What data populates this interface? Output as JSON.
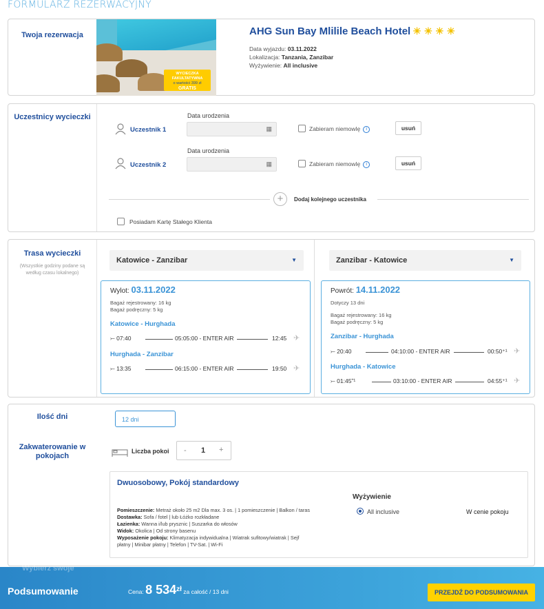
{
  "page": {
    "title": "FORMULARZ REZERWACYJNY"
  },
  "reservation": {
    "label": "Twoja rezerwacja",
    "hotel_name": "AHG Sun Bay Mlilile Beach Hotel",
    "stars": "☀ ☀ ☀ ☀",
    "promo_line1": "WYCIECZKA FAKULTATYWNA",
    "promo_line2": "o wartości 399 zł",
    "promo_line3": "GRATIS",
    "departure_label": "Data wyjazdu:",
    "departure_value": "03.11.2022",
    "location_label": "Lokalizacja:",
    "location_value": "Tanzania, Zanzibar",
    "board_label": "Wyżywienie:",
    "board_value": "All inclusive"
  },
  "participants": {
    "label": "Uczestnicy wycieczki",
    "birth_label": "Data urodzenia",
    "infant_label": "Zabieram niemowlę",
    "remove_label": "usuń",
    "list": [
      "Uczestnik 1",
      "Uczestnik 2"
    ],
    "add_label": "Dodaj kolejnego uczestnika",
    "loyalty_label": "Posiadam Kartę Stałego Klienta"
  },
  "route": {
    "label": "Trasa wycieczki",
    "note": "(Wszystkie godziny podane są według czasu lokalnego)",
    "outbound_select": "Katowice - Zanzibar",
    "return_select": "Zanzibar - Katowice",
    "outbound": {
      "head_label": "Wylot:",
      "date": "03.11.2022",
      "baggage1": "Bagaż rejestrowany: 16 kg",
      "baggage2": "Bagaż podręczny: 5 kg",
      "legs": [
        {
          "route": "Katowice - Hurghada",
          "dep": "07:40",
          "info": "05:05:00 - ENTER AIR",
          "arr": "12:45"
        },
        {
          "route": "Hurghada - Zanzibar",
          "dep": "13:35",
          "info": "06:15:00 - ENTER AIR",
          "arr": "19:50"
        }
      ]
    },
    "inbound": {
      "head_label": "Powrót:",
      "date": "14.11.2022",
      "days": "Dotyczy 13 dni",
      "baggage1": "Bagaż rejestrowany: 16 kg",
      "baggage2": "Bagaż podręczny: 5 kg",
      "legs": [
        {
          "route": "Zanzibar - Hurghada",
          "dep": "20:40",
          "info": "04:10:00 - ENTER AIR",
          "arr": "00:50⁺¹"
        },
        {
          "route": "Hurghada - Katowice",
          "dep": "01:45⁺¹",
          "info": "03:10:00 - ENTER AIR",
          "arr": "04:55⁺¹"
        }
      ]
    }
  },
  "stay": {
    "days_label": "Ilość dni",
    "days_value": "12 dni",
    "accommodation_label": "Zakwaterowanie w pokojach",
    "rooms_label": "Liczba pokoi",
    "rooms_minus": "-",
    "rooms_count": "1",
    "rooms_plus": "+",
    "room_title": "Dwuosobowy, Pokój standardowy",
    "board_heading": "Wyżywienie",
    "board_option": "All inclusive",
    "board_price": "W cenie pokoju",
    "details": [
      {
        "k": "Pomieszczenie:",
        "v": " Metraż około 25 m2 Dla max. 3 os. | 1 pomieszczenie | Balkon / taras"
      },
      {
        "k": "Dostawka:",
        "v": " Sofa / fotel | lub Łóżko rozkładane"
      },
      {
        "k": "Łazienka:",
        "v": " Wanna i/lub prysznic | Suszarka do włosów"
      },
      {
        "k": "Widok:",
        "v": " Okolica | Od strony basenu"
      },
      {
        "k": "Wyposażenie pokoju:",
        "v": " Klimatyzacja indywidualna | Wiatrak sufitowy/wiatrak | Sejf"
      },
      {
        "k": "",
        "v": "płatny | Minibar płatny | Telefon | TV-Sat. | Wi-Fi"
      }
    ]
  },
  "footer": {
    "title": "Podsumowanie",
    "ghost_label": "Wybierz swoje",
    "price_label": "Cena:",
    "price_value": "8 534",
    "price_currency": "zł",
    "price_note": "za całość / 13 dni",
    "cta": "PRZEJDŹ DO PODSUMOWANIA"
  }
}
